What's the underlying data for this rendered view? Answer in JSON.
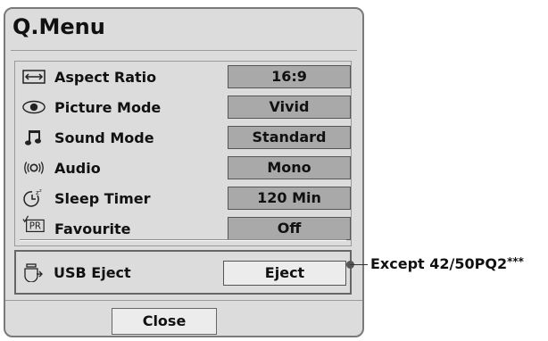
{
  "menu": {
    "title": "Q.Menu",
    "items": [
      {
        "label": "Aspect Ratio",
        "value": "16:9",
        "icon": "aspect-ratio-icon"
      },
      {
        "label": "Picture Mode",
        "value": "Vivid",
        "icon": "eye-icon"
      },
      {
        "label": "Sound Mode",
        "value": "Standard",
        "icon": "music-note-icon"
      },
      {
        "label": "Audio",
        "value": "Mono",
        "icon": "audio-icon"
      },
      {
        "label": "Sleep Timer",
        "value": "120 Min",
        "icon": "sleep-timer-icon"
      },
      {
        "label": "Favourite",
        "value": "Off",
        "icon": "favourite-pr-icon",
        "icon_text": "PR"
      }
    ],
    "usb": {
      "label": "USB Eject",
      "value": "Eject",
      "icon": "usb-eject-icon"
    },
    "close_label": "Close"
  },
  "callout": {
    "text": "Except  42/50PQ2",
    "suffix": "***"
  }
}
